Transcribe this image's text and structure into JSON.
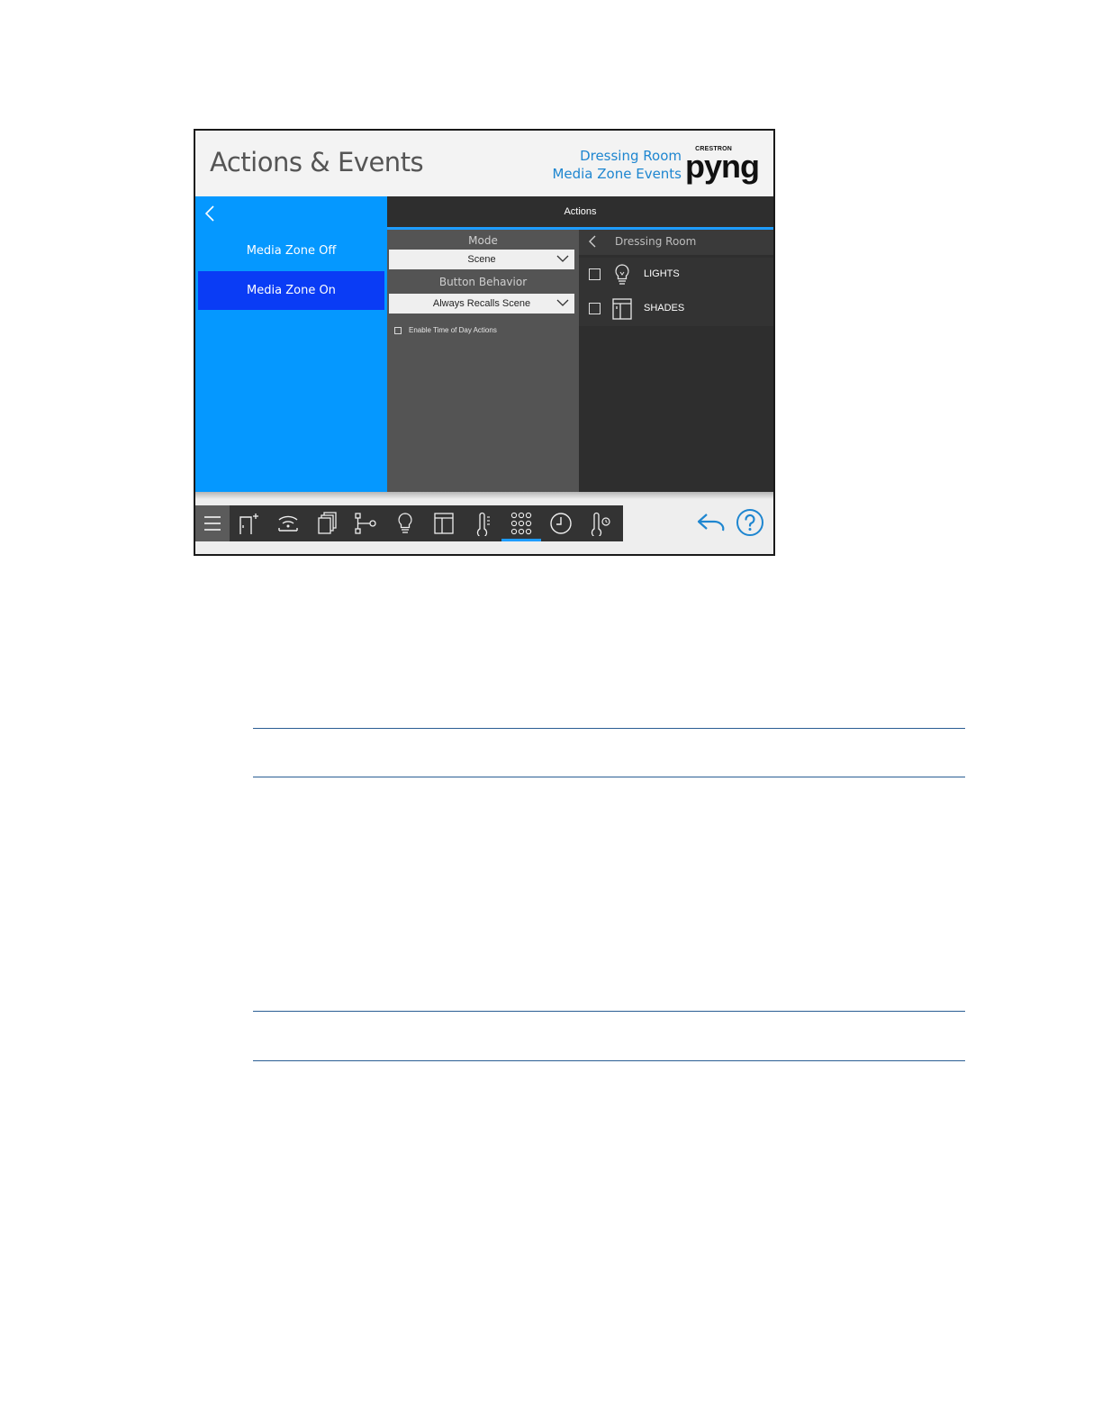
{
  "header": {
    "title": "Actions & Events",
    "context_line1": "Dressing Room",
    "context_line2": "Media Zone Events",
    "logo_brand": "CRESTRON",
    "logo_word": "pyng"
  },
  "left_panel": {
    "items": [
      {
        "label": "Media Zone Off",
        "selected": false
      },
      {
        "label": "Media Zone On",
        "selected": true
      }
    ]
  },
  "actions_tab": {
    "label": "Actions"
  },
  "settings": {
    "mode_label": "Mode",
    "mode_value": "Scene",
    "behavior_label": "Button Behavior",
    "behavior_value": "Always Recalls Scene",
    "time_of_day_label": "Enable Time of Day Actions"
  },
  "loads": {
    "room": "Dressing Room",
    "items": [
      {
        "label": "LIGHTS",
        "icon": "lightbulb-icon",
        "checked": false
      },
      {
        "label": "SHADES",
        "icon": "shade-icon",
        "checked": false
      }
    ]
  },
  "toolbar": {
    "icons": [
      "menu-icon",
      "door-add-icon",
      "wifi-device-icon",
      "scenes-icon",
      "connections-icon",
      "lightbulb-icon",
      "shade-icon",
      "thermostat-icon",
      "keypad-icon",
      "clock-icon",
      "temperature-sensor-icon"
    ],
    "active": "keypad-icon"
  },
  "colors": {
    "accent": "#1e9cff",
    "left_panel": "#0598ff",
    "selected": "#0a3cf5",
    "context_text": "#1e86d0"
  }
}
